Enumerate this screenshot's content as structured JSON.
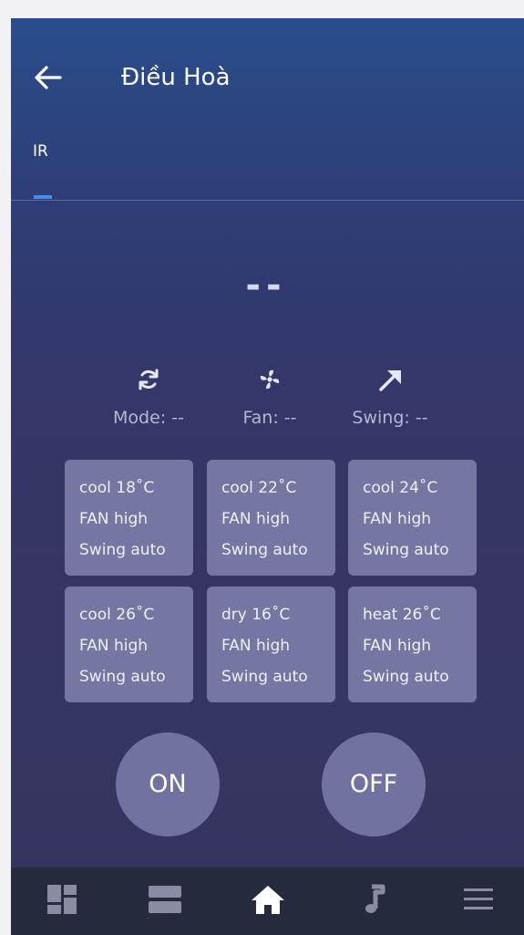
{
  "header": {
    "title": "Điều Hoà",
    "back_icon": "arrow-left-icon"
  },
  "tabs": [
    {
      "label": "IR",
      "active": true
    }
  ],
  "status": {
    "temperature": "--"
  },
  "controls": [
    {
      "icon": "refresh-icon",
      "label": "Mode: --"
    },
    {
      "icon": "fan-icon",
      "label": "Fan: --"
    },
    {
      "icon": "swing-arrow-icon",
      "label": "Swing: --"
    }
  ],
  "presets": [
    {
      "mode": "cool 18˚C",
      "fan": "FAN high",
      "swing": "Swing auto"
    },
    {
      "mode": "cool 22˚C",
      "fan": "FAN high",
      "swing": "Swing auto"
    },
    {
      "mode": "cool 24˚C",
      "fan": "FAN high",
      "swing": "Swing auto"
    },
    {
      "mode": "cool 26˚C",
      "fan": "FAN high",
      "swing": "Swing auto"
    },
    {
      "mode": "dry 16˚C",
      "fan": "FAN high",
      "swing": "Swing auto"
    },
    {
      "mode": "heat 26˚C",
      "fan": "FAN high",
      "swing": "Swing auto"
    }
  ],
  "power": {
    "on_label": "ON",
    "off_label": "OFF"
  },
  "bottom_nav": [
    {
      "icon": "dashboard-grid-icon",
      "active": false
    },
    {
      "icon": "rooms-list-icon",
      "active": false
    },
    {
      "icon": "home-icon",
      "active": true
    },
    {
      "icon": "music-note-icon",
      "active": false
    },
    {
      "icon": "menu-icon",
      "active": false
    }
  ],
  "colors": {
    "accent": "#4a8de8",
    "card": "#7676a2",
    "power_button": "#7272a0",
    "nav_bg": "#262a3d",
    "nav_icon": "#8a8ca6",
    "nav_active": "#ffffff"
  }
}
